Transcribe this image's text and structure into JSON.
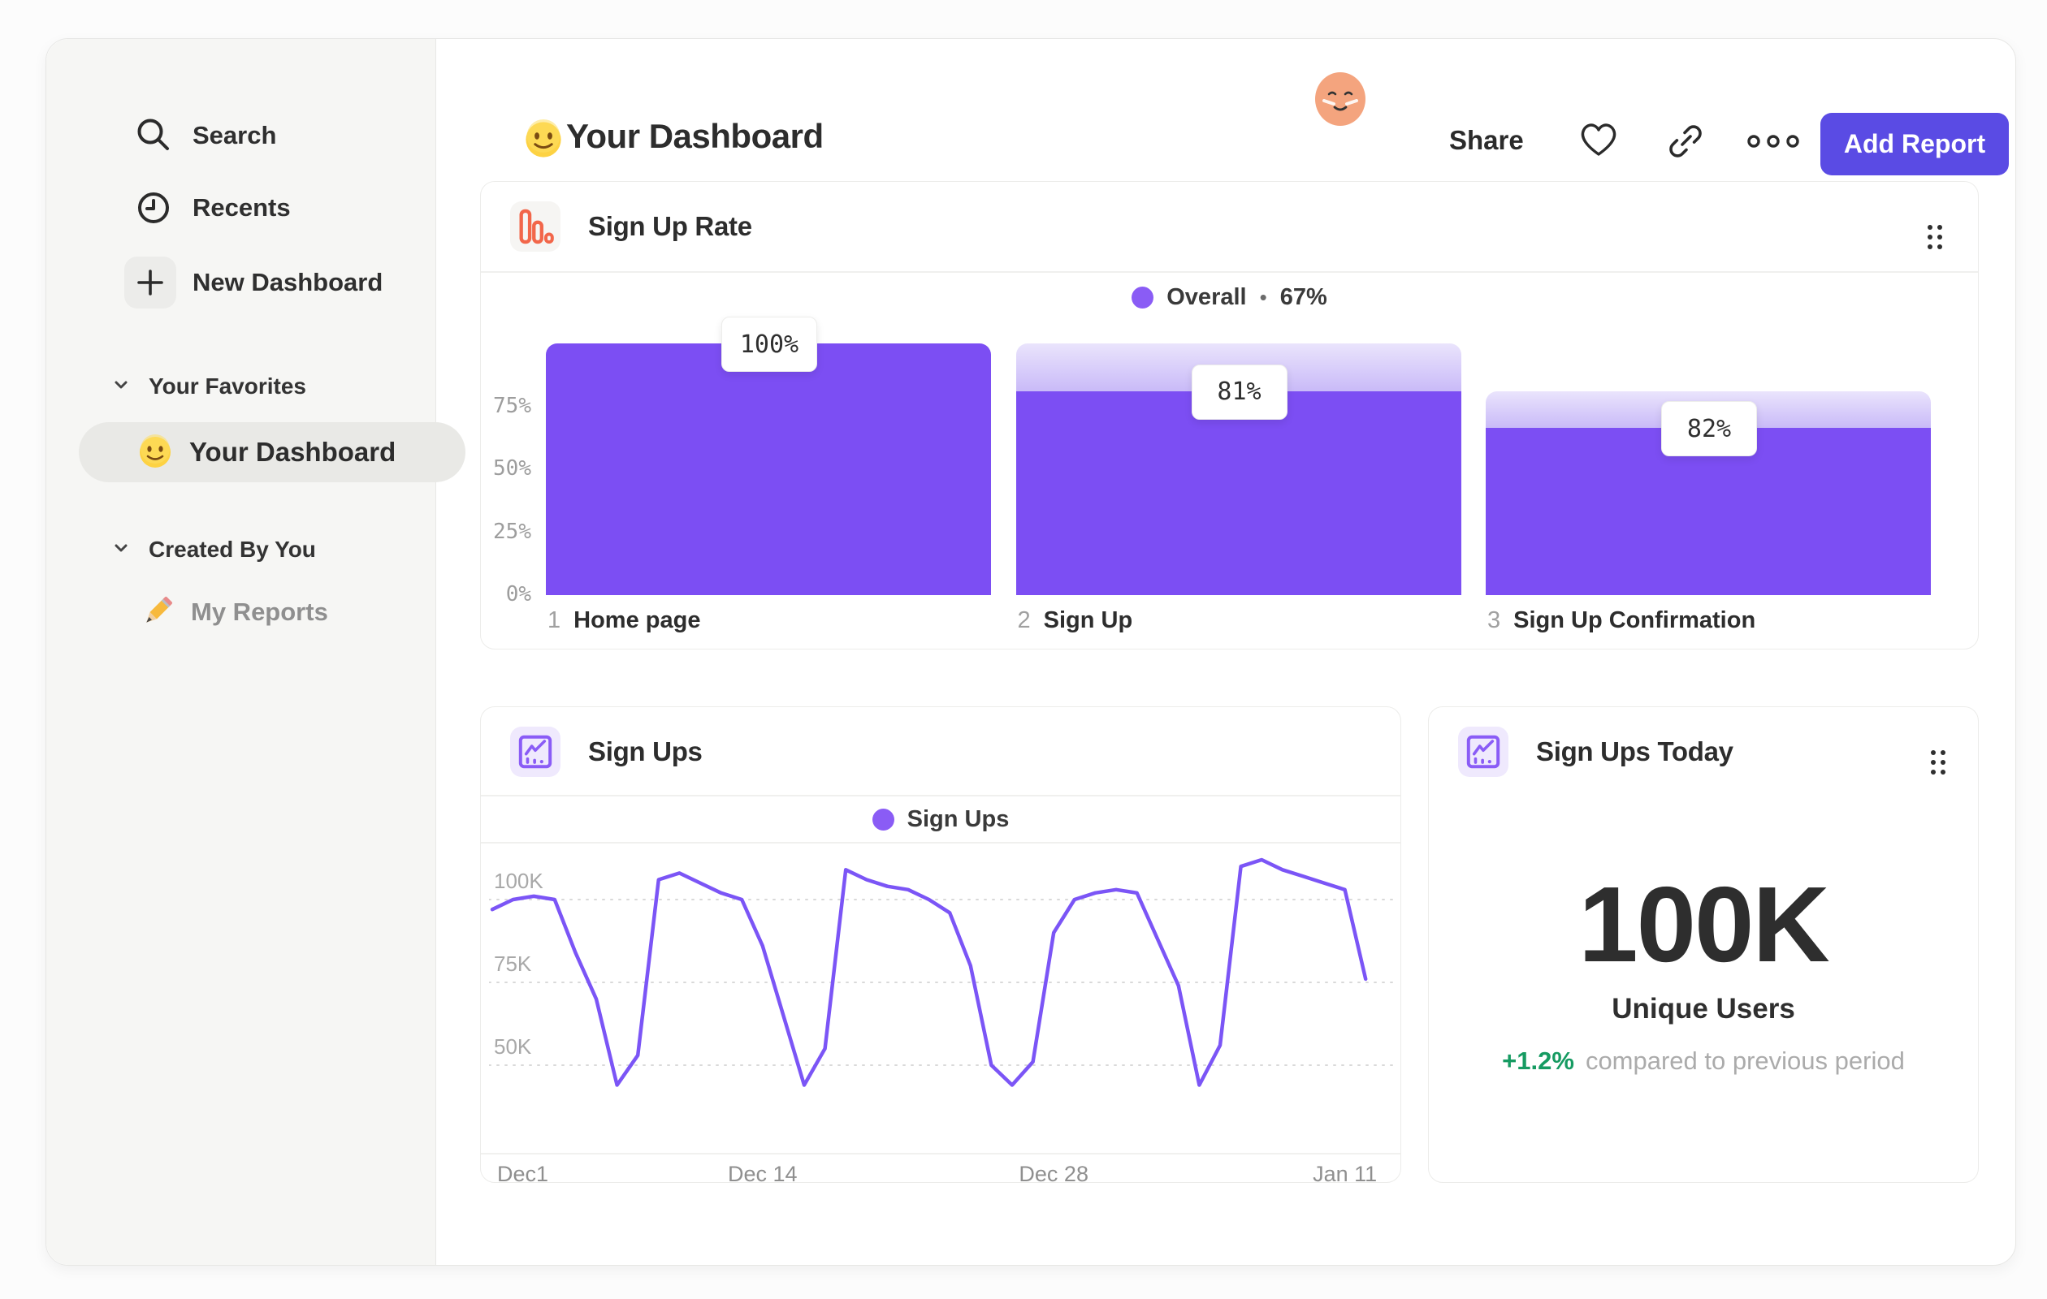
{
  "sidebar": {
    "nav": [
      {
        "label": "Search"
      },
      {
        "label": "Recents"
      },
      {
        "label": "New Dashboard"
      }
    ],
    "sections": [
      {
        "title": "Your Favorites",
        "items": [
          {
            "label": "Your Dashboard",
            "selected": true,
            "icon": "smiley-emoji"
          }
        ]
      },
      {
        "title": "Created By You",
        "items": [
          {
            "label": "My Reports",
            "selected": false,
            "icon": "pencil-emoji"
          }
        ]
      }
    ]
  },
  "header": {
    "emoji": "smiley",
    "title": "Your Dashboard",
    "share_label": "Share",
    "add_report_label": "Add Report"
  },
  "cards": {
    "signup_rate": {
      "title": "Sign Up Rate",
      "legend": {
        "label": "Overall",
        "separator": "•",
        "value": "67%"
      }
    },
    "signups": {
      "title": "Sign Ups",
      "legend_label": "Sign Ups"
    },
    "signups_today": {
      "title": "Sign Ups Today",
      "value": "100K",
      "subtitle": "Unique Users",
      "delta": "+1.2%",
      "delta_note": "compared to previous period"
    }
  },
  "chart_data": [
    {
      "type": "bar",
      "title": "Sign Up Rate",
      "legend": "Overall • 67%",
      "categories": [
        "Home page",
        "Sign Up",
        "Sign Up Confirmation"
      ],
      "step_numbers": [
        "1",
        "2",
        "3"
      ],
      "values_pct_of_previous": [
        100,
        81,
        82
      ],
      "cumulative_pct": [
        100,
        81,
        66.4
      ],
      "bar_labels": [
        "100%",
        "81%",
        "82%"
      ],
      "yticks": [
        {
          "label": "75%",
          "value": 75
        },
        {
          "label": "50%",
          "value": 50
        },
        {
          "label": "25%",
          "value": 25
        },
        {
          "label": "0%",
          "value": 0
        }
      ],
      "ylim": [
        0,
        100
      ],
      "bar_color": "#7c4ef3",
      "dropoff_gradient": [
        "#eae4fc",
        "#c9baf8"
      ],
      "grid": false,
      "legend_position": "top-center"
    },
    {
      "type": "line",
      "title": "Sign Ups",
      "series": [
        {
          "name": "Sign Ups",
          "unit": "K",
          "values": [
            97,
            100,
            101,
            100,
            84,
            70,
            44,
            53,
            106,
            108,
            105,
            102,
            100,
            86,
            65,
            44,
            55,
            109,
            106,
            104,
            103,
            100,
            96,
            80,
            50,
            44,
            51,
            90,
            100,
            102,
            103,
            102,
            88,
            74,
            44,
            56,
            110,
            112,
            109,
            107,
            105,
            103,
            76
          ]
        }
      ],
      "x_unit": "day",
      "xticks": [
        {
          "label": "Dec1",
          "day": 0
        },
        {
          "label": "Dec 14",
          "day": 13
        },
        {
          "label": "Dec 28",
          "day": 27
        },
        {
          "label": "Jan 11",
          "day": 41
        }
      ],
      "yticks": [
        {
          "label": "100K",
          "value": 100
        },
        {
          "label": "75K",
          "value": 75
        },
        {
          "label": "50K",
          "value": 50
        }
      ],
      "line_color": "#7b55f6",
      "grid": "dotted-horizontal",
      "legend_position": "top-center"
    }
  ],
  "colors": {
    "accent_purple": "#7c4ef3",
    "legend_dot_purple": "#8a5cf5",
    "button_indigo": "#5a4be4",
    "icon_orange": "#f2664a",
    "positive_green": "#169b62",
    "sidebar_bg": "#f6f6f4",
    "selected_pill": "#e9e9e6"
  }
}
